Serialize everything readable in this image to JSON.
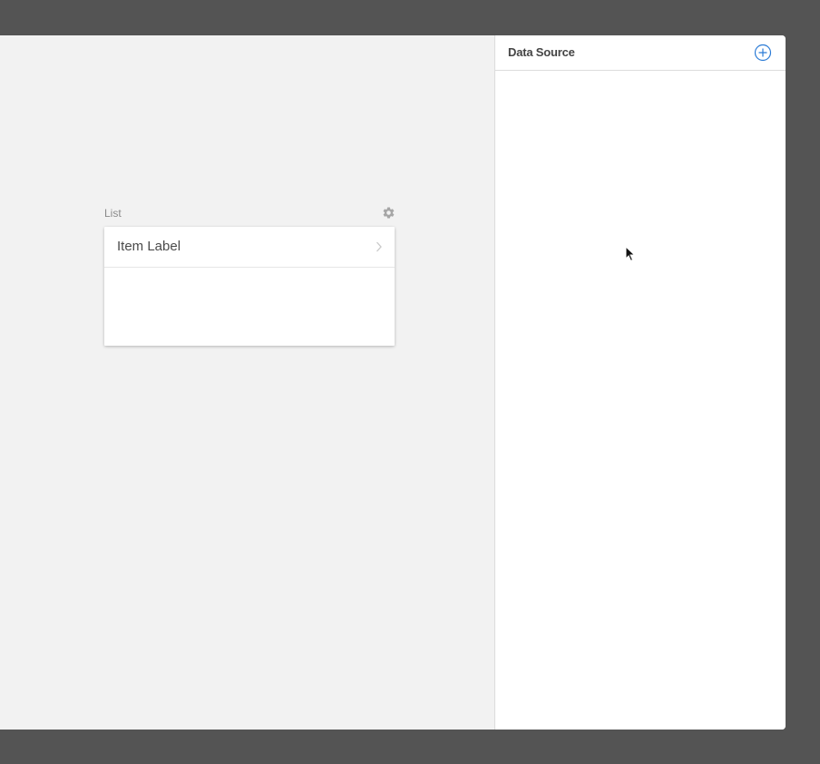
{
  "canvas": {
    "widget": {
      "title": "List",
      "settings_icon": "gear-icon",
      "items": [
        {
          "label": "Item Label",
          "icon": "chevron-right-icon"
        }
      ]
    }
  },
  "side_panel": {
    "title": "Data Source",
    "add_icon": "plus-circle-icon"
  },
  "colors": {
    "desktop_bg": "#545454",
    "canvas_bg": "#f2f2f2",
    "panel_bg": "#ffffff",
    "accent": "#2b7bd6",
    "muted_icon": "#a6a6a6"
  }
}
